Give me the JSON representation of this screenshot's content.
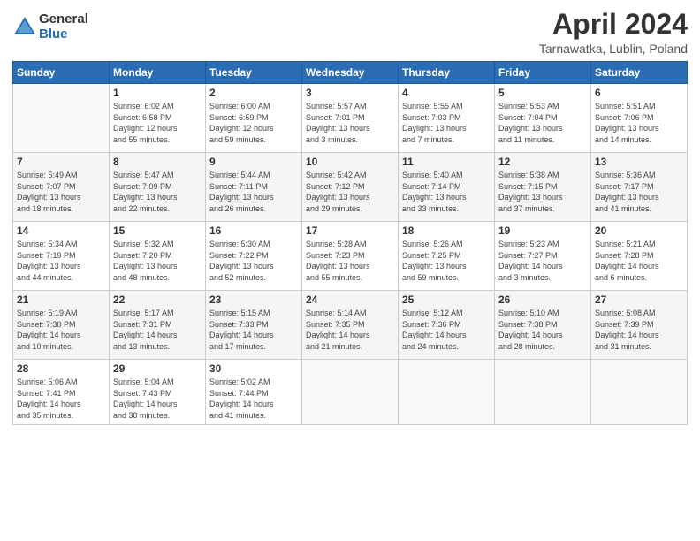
{
  "header": {
    "logo": {
      "general": "General",
      "blue": "Blue"
    },
    "title": "April 2024",
    "location": "Tarnawatka, Lublin, Poland"
  },
  "days_of_week": [
    "Sunday",
    "Monday",
    "Tuesday",
    "Wednesday",
    "Thursday",
    "Friday",
    "Saturday"
  ],
  "weeks": [
    [
      {
        "day": "",
        "info": ""
      },
      {
        "day": "1",
        "info": "Sunrise: 6:02 AM\nSunset: 6:58 PM\nDaylight: 12 hours\nand 55 minutes."
      },
      {
        "day": "2",
        "info": "Sunrise: 6:00 AM\nSunset: 6:59 PM\nDaylight: 12 hours\nand 59 minutes."
      },
      {
        "day": "3",
        "info": "Sunrise: 5:57 AM\nSunset: 7:01 PM\nDaylight: 13 hours\nand 3 minutes."
      },
      {
        "day": "4",
        "info": "Sunrise: 5:55 AM\nSunset: 7:03 PM\nDaylight: 13 hours\nand 7 minutes."
      },
      {
        "day": "5",
        "info": "Sunrise: 5:53 AM\nSunset: 7:04 PM\nDaylight: 13 hours\nand 11 minutes."
      },
      {
        "day": "6",
        "info": "Sunrise: 5:51 AM\nSunset: 7:06 PM\nDaylight: 13 hours\nand 14 minutes."
      }
    ],
    [
      {
        "day": "7",
        "info": "Sunrise: 5:49 AM\nSunset: 7:07 PM\nDaylight: 13 hours\nand 18 minutes."
      },
      {
        "day": "8",
        "info": "Sunrise: 5:47 AM\nSunset: 7:09 PM\nDaylight: 13 hours\nand 22 minutes."
      },
      {
        "day": "9",
        "info": "Sunrise: 5:44 AM\nSunset: 7:11 PM\nDaylight: 13 hours\nand 26 minutes."
      },
      {
        "day": "10",
        "info": "Sunrise: 5:42 AM\nSunset: 7:12 PM\nDaylight: 13 hours\nand 29 minutes."
      },
      {
        "day": "11",
        "info": "Sunrise: 5:40 AM\nSunset: 7:14 PM\nDaylight: 13 hours\nand 33 minutes."
      },
      {
        "day": "12",
        "info": "Sunrise: 5:38 AM\nSunset: 7:15 PM\nDaylight: 13 hours\nand 37 minutes."
      },
      {
        "day": "13",
        "info": "Sunrise: 5:36 AM\nSunset: 7:17 PM\nDaylight: 13 hours\nand 41 minutes."
      }
    ],
    [
      {
        "day": "14",
        "info": "Sunrise: 5:34 AM\nSunset: 7:19 PM\nDaylight: 13 hours\nand 44 minutes."
      },
      {
        "day": "15",
        "info": "Sunrise: 5:32 AM\nSunset: 7:20 PM\nDaylight: 13 hours\nand 48 minutes."
      },
      {
        "day": "16",
        "info": "Sunrise: 5:30 AM\nSunset: 7:22 PM\nDaylight: 13 hours\nand 52 minutes."
      },
      {
        "day": "17",
        "info": "Sunrise: 5:28 AM\nSunset: 7:23 PM\nDaylight: 13 hours\nand 55 minutes."
      },
      {
        "day": "18",
        "info": "Sunrise: 5:26 AM\nSunset: 7:25 PM\nDaylight: 13 hours\nand 59 minutes."
      },
      {
        "day": "19",
        "info": "Sunrise: 5:23 AM\nSunset: 7:27 PM\nDaylight: 14 hours\nand 3 minutes."
      },
      {
        "day": "20",
        "info": "Sunrise: 5:21 AM\nSunset: 7:28 PM\nDaylight: 14 hours\nand 6 minutes."
      }
    ],
    [
      {
        "day": "21",
        "info": "Sunrise: 5:19 AM\nSunset: 7:30 PM\nDaylight: 14 hours\nand 10 minutes."
      },
      {
        "day": "22",
        "info": "Sunrise: 5:17 AM\nSunset: 7:31 PM\nDaylight: 14 hours\nand 13 minutes."
      },
      {
        "day": "23",
        "info": "Sunrise: 5:15 AM\nSunset: 7:33 PM\nDaylight: 14 hours\nand 17 minutes."
      },
      {
        "day": "24",
        "info": "Sunrise: 5:14 AM\nSunset: 7:35 PM\nDaylight: 14 hours\nand 21 minutes."
      },
      {
        "day": "25",
        "info": "Sunrise: 5:12 AM\nSunset: 7:36 PM\nDaylight: 14 hours\nand 24 minutes."
      },
      {
        "day": "26",
        "info": "Sunrise: 5:10 AM\nSunset: 7:38 PM\nDaylight: 14 hours\nand 28 minutes."
      },
      {
        "day": "27",
        "info": "Sunrise: 5:08 AM\nSunset: 7:39 PM\nDaylight: 14 hours\nand 31 minutes."
      }
    ],
    [
      {
        "day": "28",
        "info": "Sunrise: 5:06 AM\nSunset: 7:41 PM\nDaylight: 14 hours\nand 35 minutes."
      },
      {
        "day": "29",
        "info": "Sunrise: 5:04 AM\nSunset: 7:43 PM\nDaylight: 14 hours\nand 38 minutes."
      },
      {
        "day": "30",
        "info": "Sunrise: 5:02 AM\nSunset: 7:44 PM\nDaylight: 14 hours\nand 41 minutes."
      },
      {
        "day": "",
        "info": ""
      },
      {
        "day": "",
        "info": ""
      },
      {
        "day": "",
        "info": ""
      },
      {
        "day": "",
        "info": ""
      }
    ]
  ]
}
